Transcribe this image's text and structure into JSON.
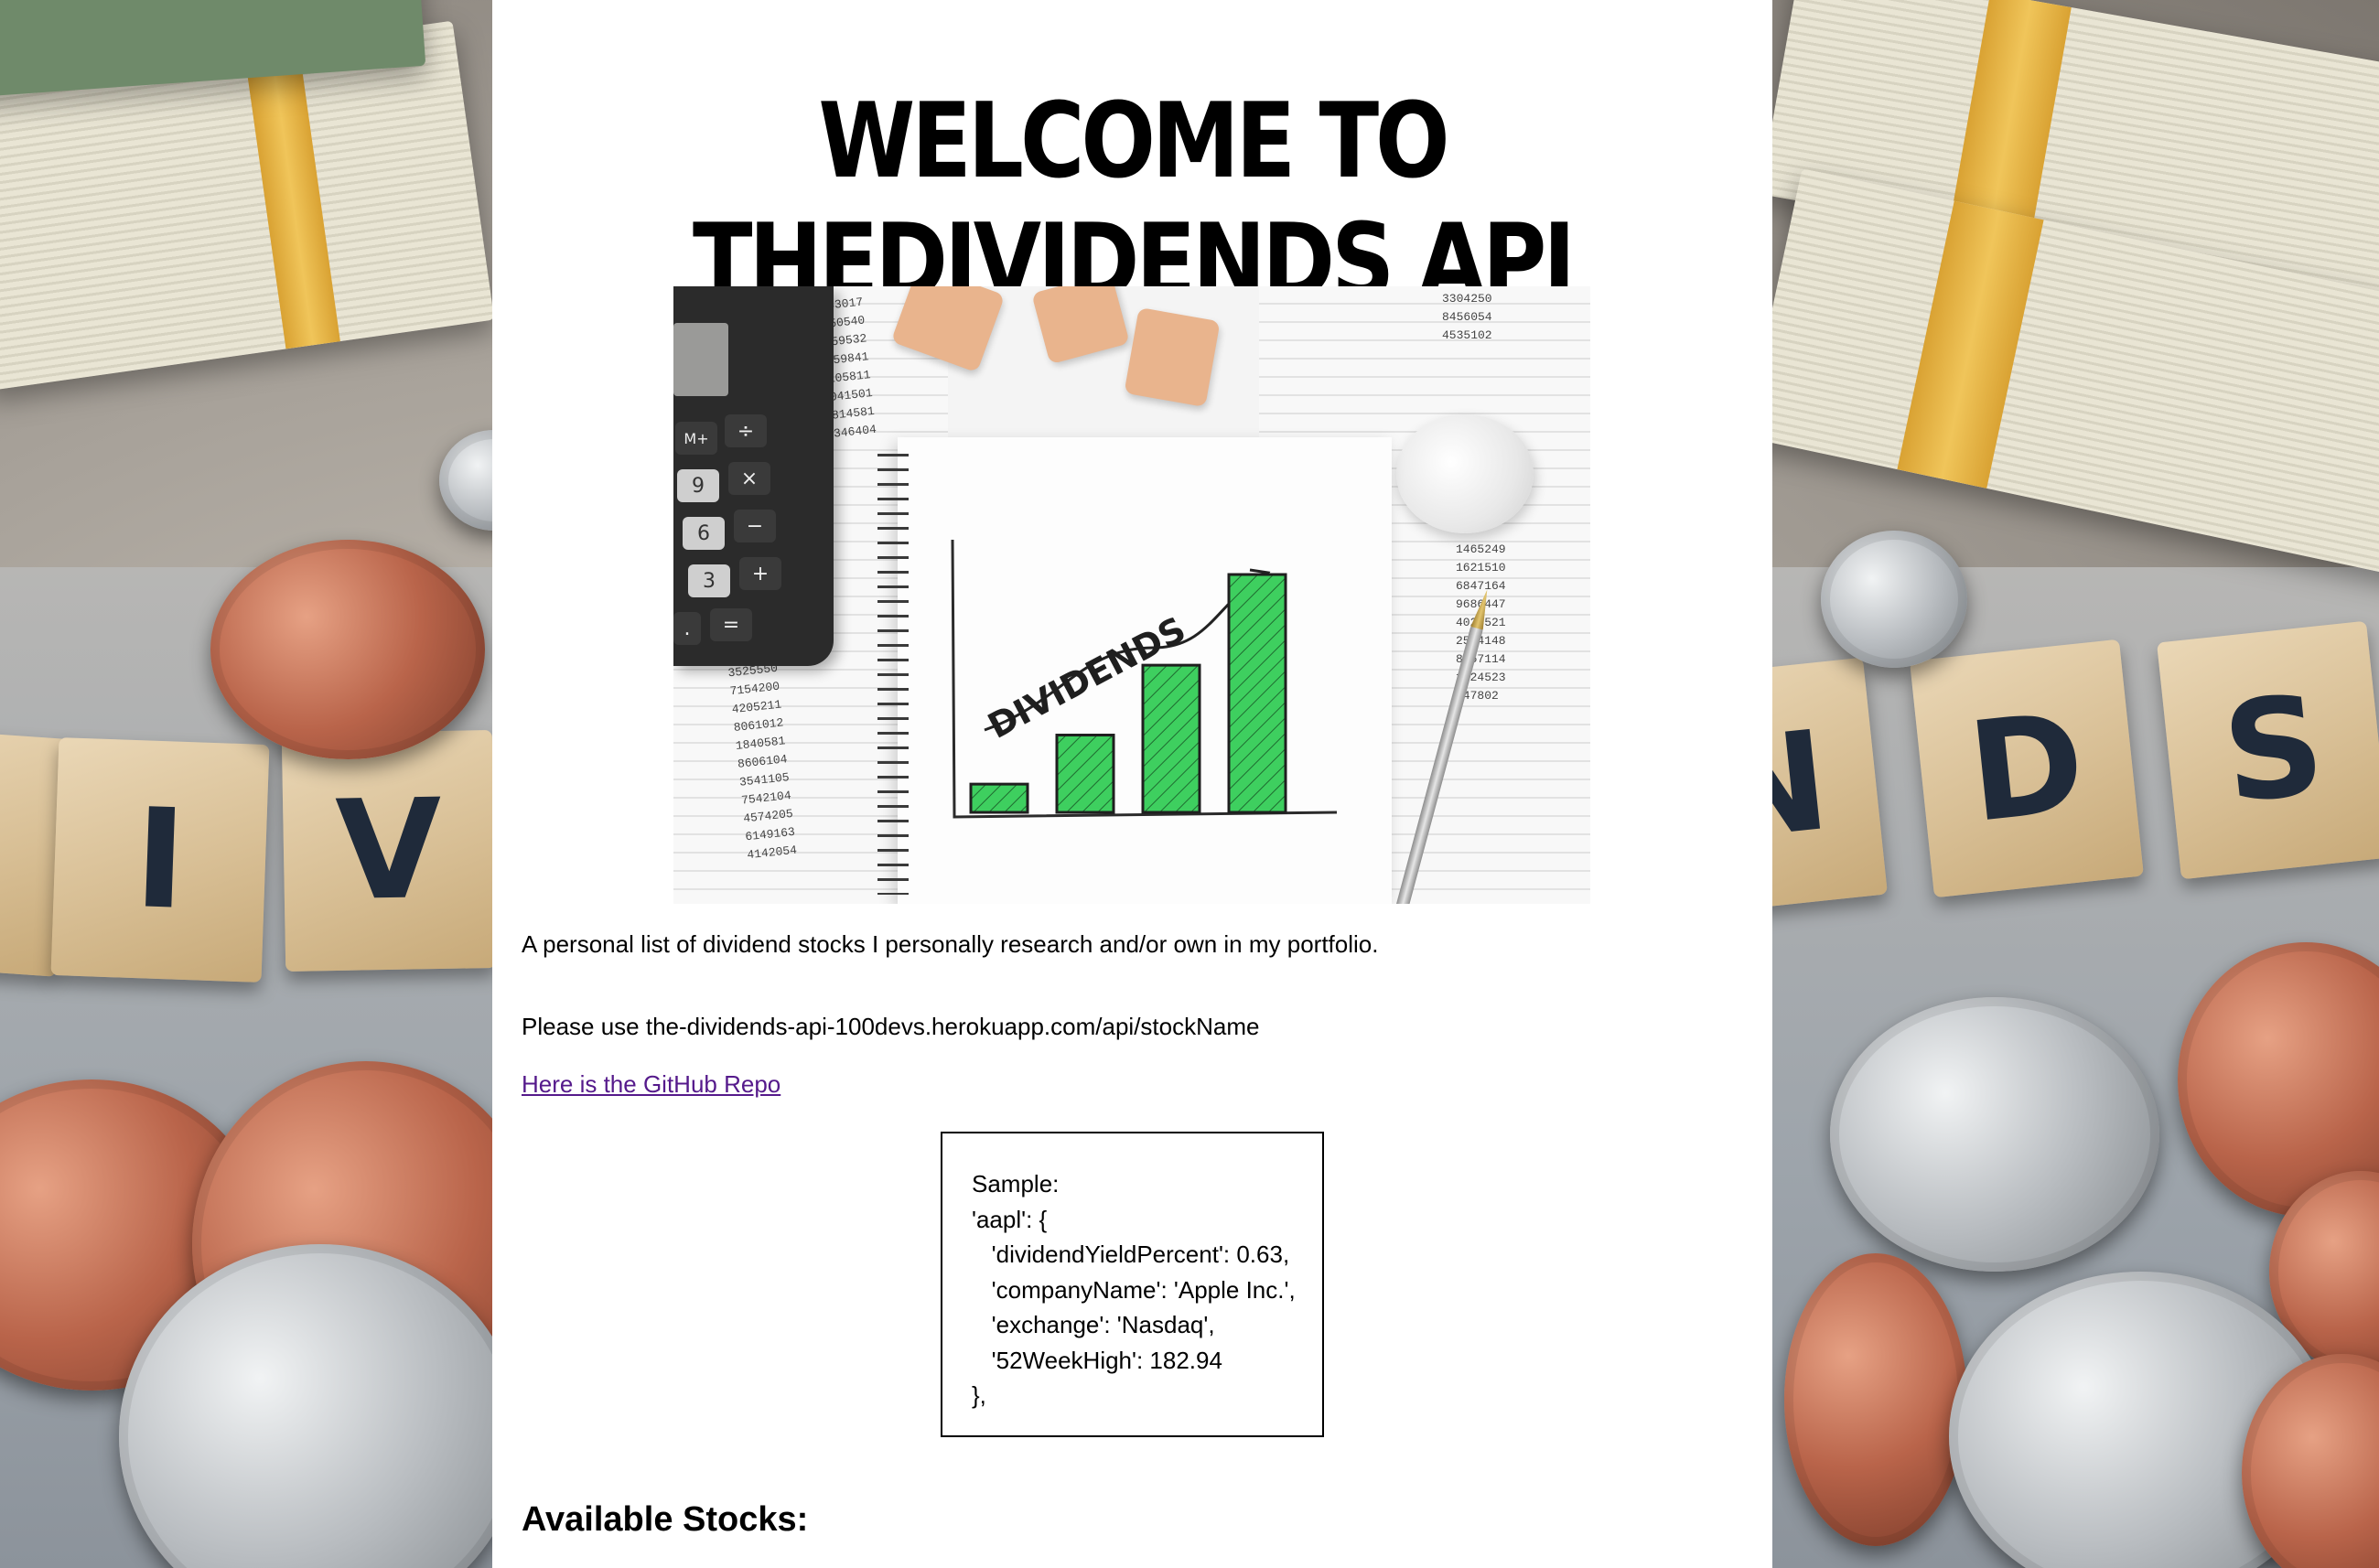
{
  "page": {
    "title": "WELCOME TO THEDIVIDENDS API",
    "intro": "A personal list of dividend stocks I personally research and/or own in my portfolio.",
    "usage": "Please use the-dividends-api-100devs.herokuapp.com/api/stockName",
    "repo_link": "Here is the GitHub Repo",
    "sample_lines": [
      "Sample:",
      "'aapl': {",
      "   'dividendYieldPercent': 0.63,",
      "   'companyName': 'Apple Inc.',",
      "   'exchange': 'Nasdaq',",
      "   '52WeekHigh': 182.94",
      "},"
    ],
    "section_heading": "Available Stocks:"
  },
  "hero_image": {
    "headline": "DIVIDENDS",
    "bar_values": [
      1,
      2,
      3,
      4
    ],
    "bar_color": "#3ecf5f",
    "spreadsheet_left": [
      "4683017",
      "6750540",
      "2559532",
      "3659841",
      "4105811",
      "8041501",
      "7814581",
      "8346404"
    ],
    "spreadsheet_left_bottom": [
      "3525550",
      "7154200",
      "4205211",
      "8061012",
      "1840581",
      "8606104",
      "3541105",
      "7542104",
      "4574205",
      "6149163",
      "4142054"
    ],
    "spreadsheet_right": [
      "3304250",
      "8456054",
      "4535102"
    ],
    "spreadsheet_right_bottom": [
      "1465249",
      "1621510",
      "6847164",
      "9686447",
      "4024521",
      "2544148",
      "8267114",
      "1524523",
      "747802"
    ],
    "calculator_keys": [
      "M+",
      "÷",
      "9",
      "×",
      "6",
      "−",
      "3",
      "+",
      ".",
      "="
    ]
  },
  "background": {
    "tiles_left": [
      "I",
      "V"
    ],
    "tiles_right": [
      "N",
      "D",
      "S"
    ]
  },
  "colors": {
    "link": "#551a8b",
    "content_bg": "#ffffff"
  }
}
